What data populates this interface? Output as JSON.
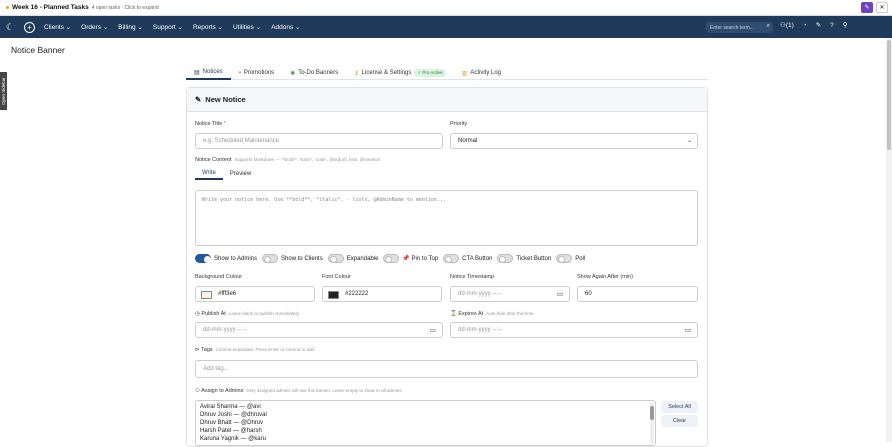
{
  "topbar": {
    "title": "Week 16 - Planned Tasks",
    "subtitle": "4 open tasks · Click to expand"
  },
  "nav": {
    "menus": [
      "Clients",
      "Orders",
      "Billing",
      "Support",
      "Reports",
      "Utilities",
      "Addons"
    ],
    "search_placeholder": "Enter search term...",
    "count_label": "(1)"
  },
  "page": {
    "title": "Notice Banner",
    "sidebar_tab": "Open Sidebar"
  },
  "tabs": [
    {
      "label": "Notices",
      "icon": "notice-icon"
    },
    {
      "label": "Promotions",
      "icon": "promotion-icon"
    },
    {
      "label": "To-Do Banners",
      "icon": "todo-icon"
    },
    {
      "label": "License & Settings",
      "icon": "key-icon",
      "badge": "✓ Pro Active"
    },
    {
      "label": "Activity Log",
      "icon": "log-icon"
    }
  ],
  "form": {
    "heading": "New Notice",
    "notice_title_label": "Notice Title",
    "notice_title_placeholder": "e.g. Scheduled Maintenance",
    "priority_label": "Priority",
    "priority_value": "Normal",
    "content_label": "Notice Content",
    "content_hint": "Supports Markdown — **bold**, *italic*, `code`, [link](url), lists, @mention",
    "write_tab": "Write",
    "preview_tab": "Preview",
    "content_placeholder": "Write your notice here. Use **bold**, *italic*, - lists, @AdminName to mention...",
    "toggles": [
      {
        "label": "Show to Admins",
        "on": true
      },
      {
        "label": "Show to Clients",
        "on": false
      },
      {
        "label": "Expandable",
        "on": false
      },
      {
        "label": "📌 Pin to Top",
        "on": false
      },
      {
        "label": "CTA Button",
        "on": false
      },
      {
        "label": "Ticket Button",
        "on": false
      },
      {
        "label": "Poll",
        "on": false
      }
    ],
    "bg_colour_label": "Background Colour",
    "bg_colour_value": "#fff3e6",
    "bg_colour_hex": "#fff3e6",
    "font_colour_label": "Font Colour",
    "font_colour_value": "#222222",
    "font_colour_hex": "#222222",
    "timestamp_label": "Notice Timestamp",
    "timestamp_placeholder": "dd-mm-yyyy --:--",
    "show_again_label": "Show Again After (min)",
    "show_again_value": "60",
    "publish_label": "Publish At",
    "publish_hint": "Leave blank to publish immediately.",
    "publish_placeholder": "dd-mm-yyyy --:--",
    "expires_label": "Expires At",
    "expires_hint": "Auto-hide after this time.",
    "expires_placeholder": "dd-mm-yyyy --:--",
    "tags_label": "Tags",
    "tags_hint": "Comma-separated. Press Enter or comma to add.",
    "tags_placeholder": "Add tag...",
    "assign_label": "Assign to Admins",
    "assign_hint": "Only assigned admins will see this banner. Leave empty to show to all admins.",
    "admins": [
      "Aviral Sharma — @avi",
      "Dhruv Joshi — @dhruval",
      "Dhruv Bhatt — @Dhruv",
      "Harsh Patel — @harsh",
      "Karuna Yagnik — @karu"
    ],
    "select_all": "Select All",
    "clear": "Clear"
  }
}
